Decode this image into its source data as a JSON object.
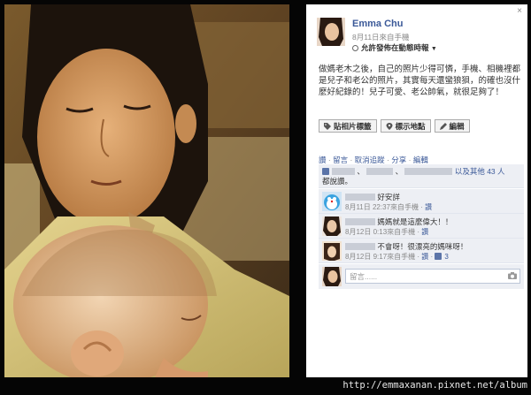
{
  "panel": {
    "close_glyph": "×",
    "author_name": "Emma Chu",
    "meta": "8月11日來自手機",
    "privacy": "允許發佈在動態時報",
    "privacy_caret": "▼",
    "caption": "做媽老木之後，自己的照片少得可憐，手機、相機裡都是兒子和老公的照片，其實每天還蠻狼狽，的確也沒什麼好紀錄的！兒子可愛、老公帥氣，就很足夠了！",
    "tag_photo": "貼相片標籤",
    "tag_location": "標示地點",
    "tag_edit": "編輯",
    "actions": {
      "like": "讚",
      "comment": "留言",
      "unfollow": "取消追蹤",
      "share": "分享",
      "edit": "編輯"
    },
    "likes_suffix": "以及其他 43 人",
    "likes_line2": "都說讚。",
    "comments": [
      {
        "text": "好安詳",
        "time": "8月11日 22:37來自手機",
        "like": "讚"
      },
      {
        "text": "媽媽就是這麼偉大！！",
        "time": "8月12日 0:13來自手機",
        "like": "讚"
      },
      {
        "text": "不會呀！很漂亮的媽咪呀！",
        "time": "8月12日 9:17來自手機",
        "like": "讚",
        "likes_count": "3"
      }
    ],
    "write_placeholder": "留言......"
  },
  "footer": {
    "url": "http://emmaxanan.pixnet.net/album"
  },
  "colors": {
    "link": "#3b5998",
    "comment_bg": "#edeff4"
  }
}
